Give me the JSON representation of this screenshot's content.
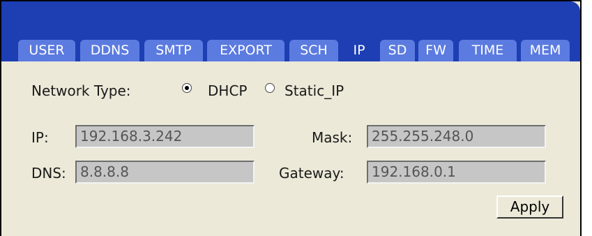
{
  "tabs": [
    "USER",
    "DDNS",
    "SMTP",
    "EXPORT",
    "SCH",
    "IP",
    "SD",
    "FW",
    "TIME",
    "MEM"
  ],
  "active_tab": "IP",
  "network_type": {
    "label": "Network Type:",
    "options": [
      "DHCP",
      "Static_IP"
    ],
    "selected": "DHCP"
  },
  "fields": {
    "ip": {
      "label": "IP:",
      "value": "192.168.3.242"
    },
    "mask": {
      "label": "Mask:",
      "value": "255.255.248.0"
    },
    "dns": {
      "label": "DNS:",
      "value": "8.8.8.8"
    },
    "gateway": {
      "label": "Gateway:",
      "value": "192.168.0.1"
    }
  },
  "apply_label": "Apply"
}
